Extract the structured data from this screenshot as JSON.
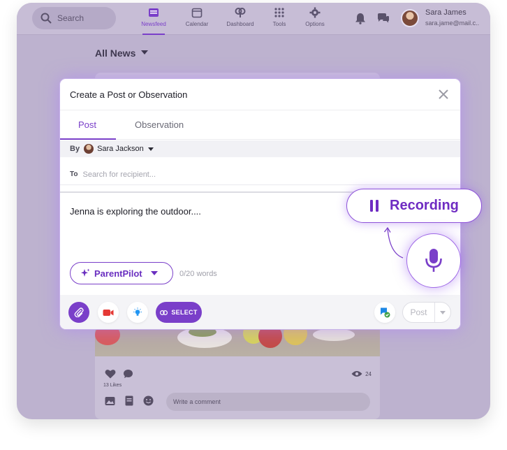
{
  "topbar": {
    "search_placeholder": "Search",
    "nav": [
      {
        "label": "Newsfeed",
        "icon": "newsfeed-icon",
        "active": true
      },
      {
        "label": "Calendar",
        "icon": "calendar-icon",
        "active": false
      },
      {
        "label": "Dashboard",
        "icon": "dashboard-icon",
        "active": false
      },
      {
        "label": "Tools",
        "icon": "grid-icon",
        "active": false
      },
      {
        "label": "Options",
        "icon": "gear-icon",
        "active": false
      }
    ],
    "user": {
      "name": "Sara James",
      "email": "sara.jame@mail.c.."
    }
  },
  "feed": {
    "heading": "All News",
    "likes": "13 Likes",
    "views": "24",
    "comment_placeholder": "Write a comment"
  },
  "modal": {
    "title": "Create a Post or Observation",
    "tabs": [
      "Post",
      "Observation"
    ],
    "active_tab": "Post",
    "by_label": "By",
    "author": "Sara Jackson",
    "to_label": "To",
    "to_placeholder": "Search for recipient...",
    "body": "Jenna is exploring the outdoor....",
    "assistant_label": "ParentPilot",
    "word_count": "0/20 words",
    "select_label": "SELECT",
    "post_label": "Post"
  },
  "recording": {
    "label": "Recording"
  },
  "colors": {
    "accent": "#7a3fc9",
    "overlay": "#bdb2cf",
    "video": "#e53935",
    "idea": "#2196f3",
    "flag": "#1e88e5",
    "check": "#43a047"
  }
}
